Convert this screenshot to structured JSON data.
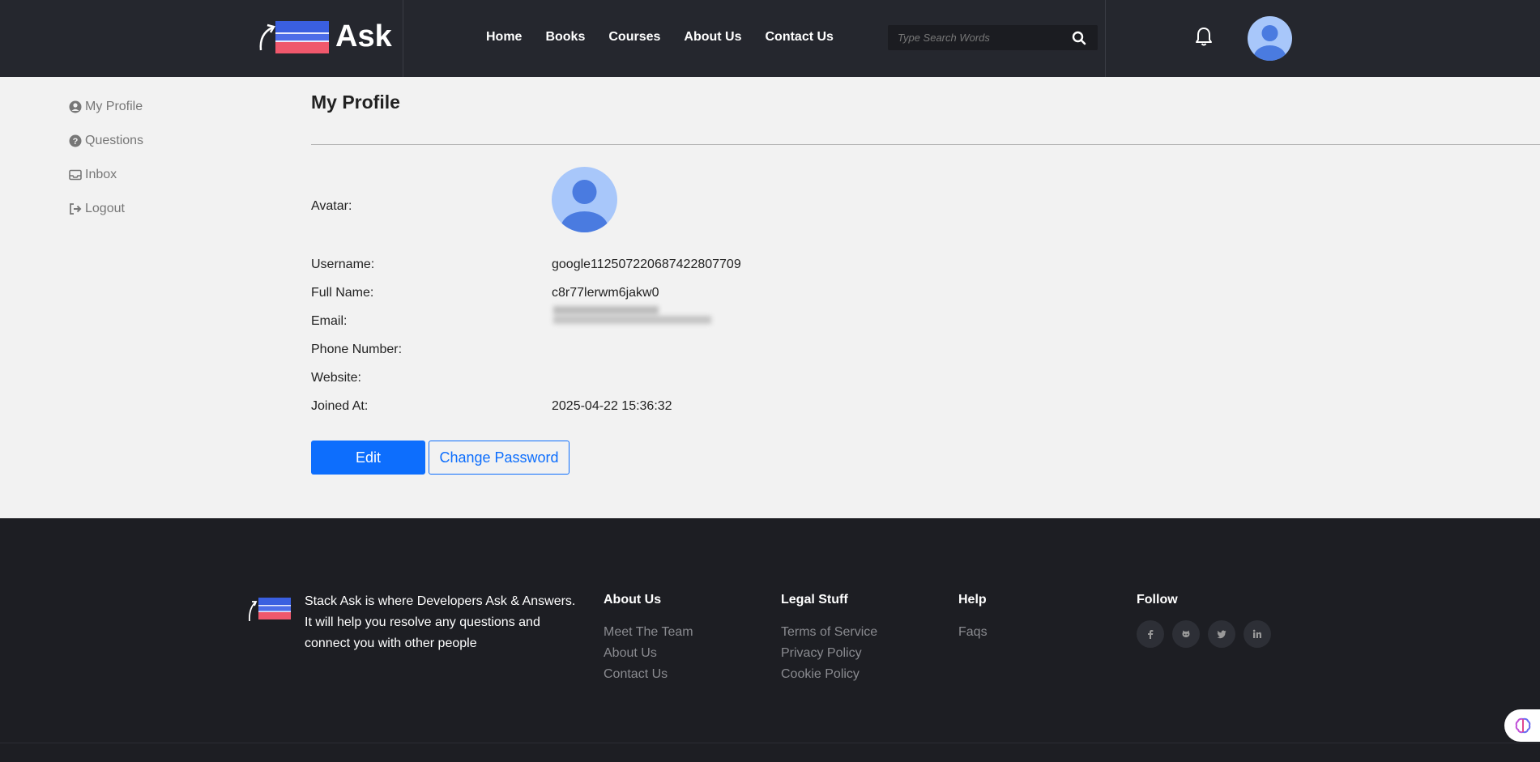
{
  "header": {
    "logo_text": "Ask",
    "nav": [
      "Home",
      "Books",
      "Courses",
      "About Us",
      "Contact Us"
    ],
    "search_placeholder": "Type Search Words"
  },
  "sidebar": {
    "items": [
      {
        "label": "My Profile",
        "icon": "user-circle-icon"
      },
      {
        "label": "Questions",
        "icon": "question-circle-icon"
      },
      {
        "label": "Inbox",
        "icon": "inbox-icon"
      },
      {
        "label": "Logout",
        "icon": "logout-icon"
      }
    ]
  },
  "profile": {
    "title": "My Profile",
    "avatar_label": "Avatar:",
    "username_label": "Username:",
    "username": "google112507220687422807709",
    "fullname_label": "Full Name:",
    "fullname": "c8r77lerwm6jakw0",
    "email_label": "Email:",
    "phone_label": "Phone Number:",
    "website_label": "Website:",
    "joined_label": "Joined At:",
    "joined": "2025-04-22 15:36:32",
    "edit_button": "Edit",
    "change_password_button": "Change Password"
  },
  "footer": {
    "about_text": "Stack Ask is where Developers Ask & Answers. It will help you resolve any questions and connect you with other people",
    "about_us": {
      "heading": "About Us",
      "links": [
        "Meet The Team",
        "About Us",
        "Contact Us"
      ]
    },
    "legal": {
      "heading": "Legal Stuff",
      "links": [
        "Terms of Service",
        "Privacy Policy",
        "Cookie Policy"
      ]
    },
    "help": {
      "heading": "Help",
      "links": [
        "Faqs"
      ]
    },
    "follow": {
      "heading": "Follow",
      "icons": [
        "facebook-icon",
        "github-icon",
        "twitter-icon",
        "linkedin-icon"
      ]
    }
  },
  "colors": {
    "header_bg": "#25272e",
    "footer_bg": "#1d1e23",
    "primary": "#0d6efd",
    "avatar_bg": "#a8c7fa",
    "avatar_fg": "#4a7be0"
  }
}
